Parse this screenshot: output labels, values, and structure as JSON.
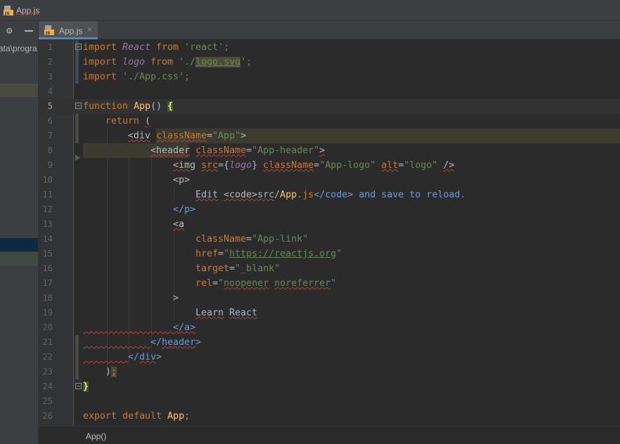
{
  "window": {
    "title": "App.js"
  },
  "left_panel": {
    "path_text": "ata\\progra"
  },
  "tabs": [
    {
      "label": "App.js",
      "close": "×"
    }
  ],
  "editor": {
    "line_numbers": [
      "1",
      "2",
      "3",
      "4",
      "5",
      "6",
      "7",
      "8",
      "9",
      "10",
      "11",
      "12",
      "13",
      "14",
      "15",
      "16",
      "17",
      "18",
      "19",
      "20",
      "21",
      "22",
      "23",
      "24",
      "25",
      "26"
    ],
    "current_line": "5",
    "lines": {
      "l1": [
        "import",
        "React",
        "from",
        "'react';"
      ],
      "l2": [
        "import",
        "logo",
        "from",
        "'./",
        "logo.svg",
        "';"
      ],
      "l3": [
        "import",
        "'./App.css';"
      ],
      "l5": [
        "function",
        "App",
        "()",
        "{"
      ],
      "l6": [
        "return",
        "("
      ],
      "l7": [
        "<div",
        "className",
        "=",
        "\"App\"",
        ">"
      ],
      "l8": [
        "<header",
        "className",
        "=",
        "\"App-header\"",
        ">"
      ],
      "l9": [
        "<img",
        "src",
        "={",
        "logo",
        "}",
        "className",
        "=",
        "\"App-logo\"",
        "alt",
        "=",
        "\"logo\"",
        "/>"
      ],
      "l10": [
        "<p>"
      ],
      "l11": [
        "Edit",
        "<code>",
        "src",
        "/",
        "App",
        ".js",
        "</code>",
        "and save to reload."
      ],
      "l12": [
        "</p>"
      ],
      "l13": [
        "<a"
      ],
      "l14": [
        "className",
        "=",
        "\"App-link\""
      ],
      "l15": [
        "href",
        "=",
        "\"",
        "https://reactjs.org",
        "\""
      ],
      "l16": [
        "target",
        "=",
        "\"_blank\""
      ],
      "l17": [
        "rel",
        "=",
        "\"",
        "noopener",
        "noreferrer",
        "\""
      ],
      "l18": [
        ">"
      ],
      "l19": [
        "Learn",
        "React"
      ],
      "l20": [
        "</a>"
      ],
      "l21": [
        "</",
        "header",
        ">"
      ],
      "l22": [
        "</",
        "div",
        ">"
      ],
      "l23": [
        ")",
        ";"
      ],
      "l24": [
        "}"
      ],
      "l26": [
        "export",
        "default",
        "App",
        ";"
      ]
    }
  },
  "breadcrumb": {
    "text": "App()"
  },
  "colors": {
    "keyword": "#cc7832",
    "string": "#6a8759",
    "function": "#ffc66d",
    "identifier": "#9876aa",
    "tag": "#e8bf6a",
    "text": "#a9b7c6",
    "tab_accent": "#4a88c7"
  }
}
